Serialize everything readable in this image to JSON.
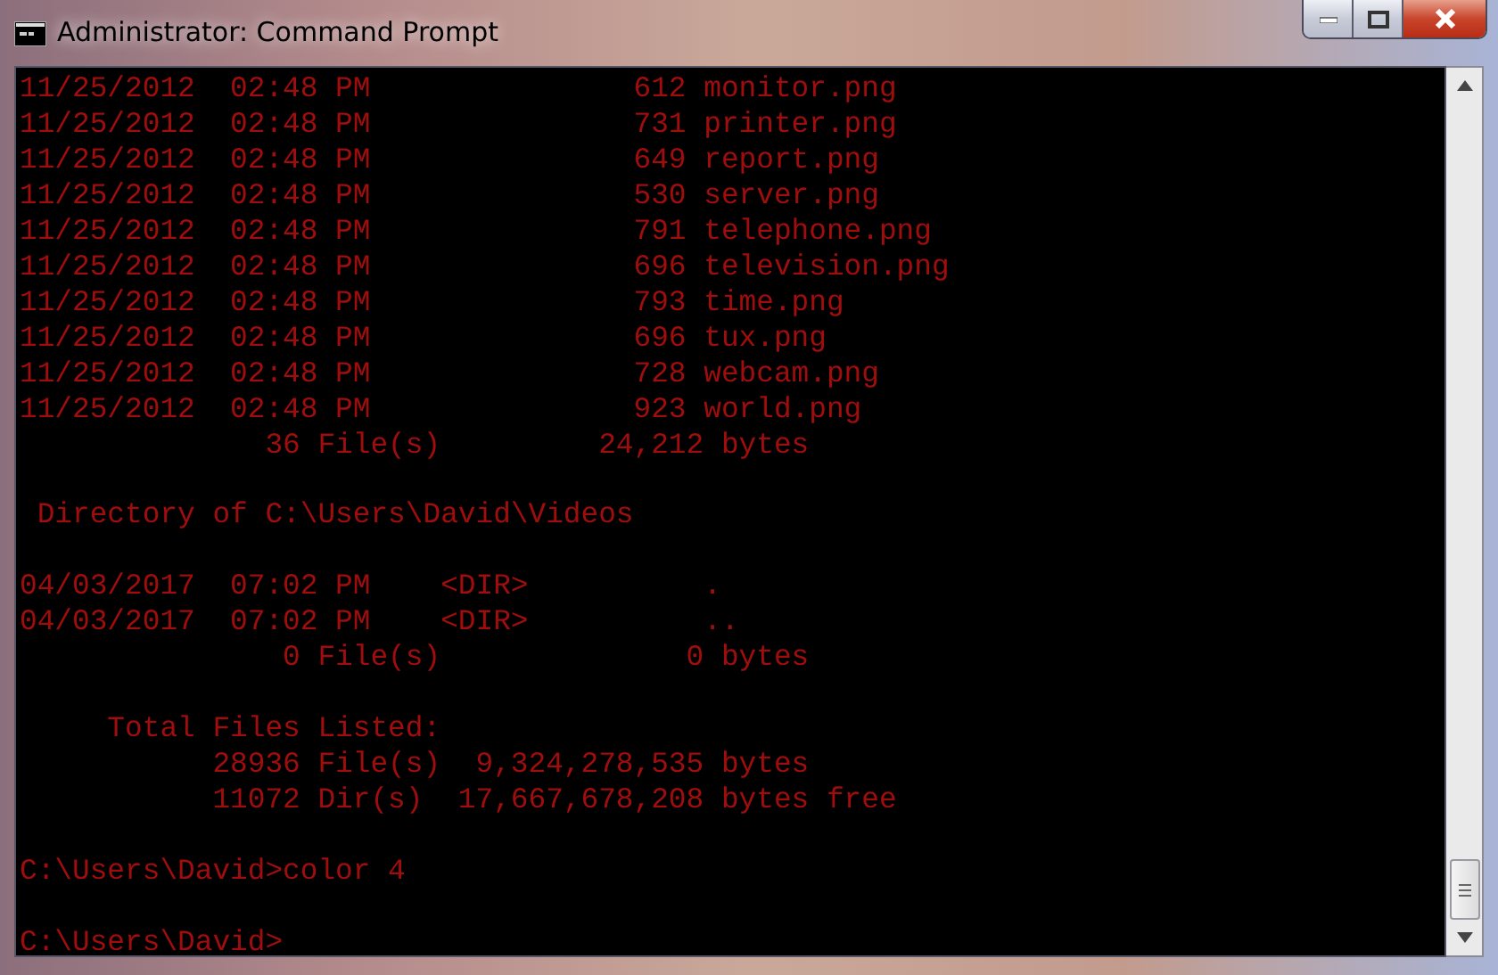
{
  "window": {
    "title": "Administrator: Command Prompt"
  },
  "console": {
    "blocks": [
      [
        "11/25/2012  02:48 PM               612 monitor.png",
        "11/25/2012  02:48 PM               731 printer.png",
        "11/25/2012  02:48 PM               649 report.png",
        "11/25/2012  02:48 PM               530 server.png",
        "11/25/2012  02:48 PM               791 telephone.png",
        "11/25/2012  02:48 PM               696 television.png",
        "11/25/2012  02:48 PM               793 time.png",
        "11/25/2012  02:48 PM               696 tux.png",
        "11/25/2012  02:48 PM               728 webcam.png",
        "11/25/2012  02:48 PM               923 world.png",
        "              36 File(s)         24,212 bytes"
      ],
      [
        " Directory of C:\\Users\\David\\Videos"
      ],
      [
        "04/03/2017  07:02 PM    <DIR>          .",
        "04/03/2017  07:02 PM    <DIR>          ..",
        "               0 File(s)              0 bytes"
      ],
      [
        "     Total Files Listed:",
        "           28936 File(s)  9,324,278,535 bytes",
        "           11072 Dir(s)  17,667,678,208 bytes free"
      ],
      [
        "C:\\Users\\David>color 4"
      ],
      [
        "C:\\Users\\David>"
      ]
    ]
  }
}
